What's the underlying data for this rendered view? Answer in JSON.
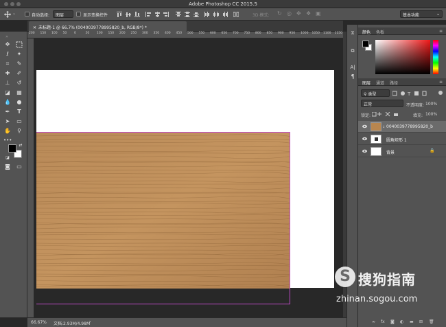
{
  "app": {
    "title": "Adobe Photoshop CC 2015.5"
  },
  "options_bar": {
    "auto_select_label": "自动选择:",
    "auto_select_value": "图层",
    "show_transform_label": "显示变换控件",
    "mode_3d_label": "3D 模式:",
    "workspace_value": "基本功能"
  },
  "document_tab": {
    "label": "未标题-1 @ 66.7% (0040039778995820_b, RGB/8*) *"
  },
  "ruler": {
    "ticks": [
      "200",
      "150",
      "100",
      "50",
      "0",
      "50",
      "100",
      "150",
      "200",
      "250",
      "300",
      "350",
      "400",
      "450",
      "500",
      "550",
      "600",
      "650",
      "700",
      "750",
      "800",
      "850",
      "900",
      "950",
      "1000",
      "1050",
      "1100",
      "1150"
    ]
  },
  "status_bar": {
    "zoom": "66.67%",
    "doc_info": "文档:2.93M/4.98M"
  },
  "color_panel": {
    "tabs": [
      "颜色",
      "色板"
    ],
    "foreground": "#000000",
    "background": "#ffffff"
  },
  "layers_panel": {
    "tabs": [
      "图层",
      "通道",
      "路径"
    ],
    "filter_label": "类型",
    "blend_mode": "正常",
    "opacity_label": "不透明度:",
    "opacity_value": "100%",
    "lock_label": "锁定:",
    "fill_label": "填充:",
    "fill_value": "100%",
    "layers": [
      {
        "name": "0040039778995820_b",
        "selected": true
      },
      {
        "name": "圆角矩形 1",
        "selected": false
      },
      {
        "name": "背景",
        "selected": false
      }
    ],
    "bottom_icons": [
      "link-icon",
      "fx-icon",
      "mask-icon",
      "adjustment-icon",
      "folder-icon",
      "new-layer-icon",
      "trash-icon"
    ],
    "fx_label": "fx"
  },
  "watermark": {
    "brand": "搜狗指南",
    "url": "zhinan.sogou.com",
    "logo_letter": "S"
  }
}
